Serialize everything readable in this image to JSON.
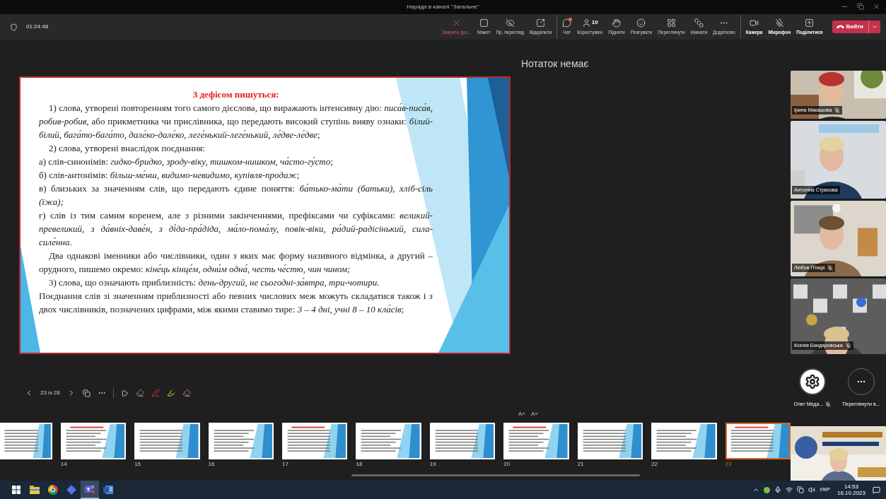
{
  "window": {
    "title": "Нарада в каналі \"Загальне\""
  },
  "meeting_bar": {
    "timer": "01:24:48",
    "action_groups": [
      [
        {
          "label": "Закрити дос...",
          "kind": "danger",
          "off": false,
          "notification": false
        },
        {
          "label": "Макет",
          "kind": "normal",
          "off": false,
          "notification": false
        },
        {
          "label": "Пр. перегляд",
          "kind": "normal",
          "off": true,
          "notification": false
        },
        {
          "label": "Відкріпити",
          "kind": "normal",
          "off": false,
          "notification": false
        }
      ],
      [
        {
          "label": "Чат",
          "kind": "normal",
          "off": false,
          "notification": true
        },
        {
          "label": "Користувачі",
          "kind": "normal",
          "off": false,
          "notification": false,
          "count": "10"
        },
        {
          "label": "Підняти",
          "kind": "normal",
          "off": false,
          "notification": false
        },
        {
          "label": "Реагувати",
          "kind": "normal",
          "off": false,
          "notification": false
        },
        {
          "label": "Переглянути",
          "kind": "normal",
          "off": false,
          "notification": false
        },
        {
          "label": "Кімнати",
          "kind": "normal",
          "off": false,
          "notification": false
        },
        {
          "label": "Додатково",
          "kind": "normal",
          "off": false,
          "notification": false
        }
      ],
      [
        {
          "label": "Камера",
          "kind": "device",
          "off": false,
          "notification": false
        },
        {
          "label": "Мікрофон",
          "kind": "device",
          "off": true,
          "notification": false
        },
        {
          "label": "Поділитися",
          "kind": "device",
          "off": false,
          "notification": false
        }
      ]
    ],
    "leave_button": {
      "label": "Вийти"
    }
  },
  "slide": {
    "title": "З дефісом пишуться:",
    "paragraphs": [
      {
        "kind": "indented",
        "text": "1) слова, утворені повторенням того самого дієслова, що виражають інтенсивну дію: *писа́в-писа́в, робив-робив*, або прикметника чи прислівника, що передають високий ступінь вияву ознаки: *білий-білий, бага́то-бага́то, дале́ко-дале́ко, леге́нький-леге́нький, ле́две-ле́две*;"
      },
      {
        "kind": "indented",
        "text": "2) слова, утворені внаслідок поєднання:"
      },
      {
        "kind": "plain",
        "text": "а) слів-синонімів: *гидко-бридко, зроду-віку, тишком-нишком, ча́сто-гу́сто*;"
      },
      {
        "kind": "plain",
        "text": "б) слів-антонімів: *більш-ме́нш, видимо-невидимо, купівля-продаж*;"
      },
      {
        "kind": "plain",
        "text": "в) близьких за значенням слів, що передають єдине поняття: *ба́тько-ма́ти (батьки), хліб-сіль (їжа);*"
      },
      {
        "kind": "plain",
        "text": "г) слів із тим самим коренем, але з різними закінченнями, префіксами чи суфіксами: *великий-превеликий, з да́вніх-даве́н, з ді́да-пра́діда, ма́ло-пома́лу, повік-віки, ра́дий-радісінький, сила-силе́нна*."
      },
      {
        "kind": "indented",
        "text": "Два однакові іменники або числівники, один з яких має форму називного відмінка, а другий – орудного, пишемо окремо: *кіне́ць кінце́м, одни́м одна́, честь че́стю, чин чином;*"
      },
      {
        "kind": "indented",
        "text": "3) слова, що означають приблизність: *день-другий, не сьогодні-за́втра, три-чотири.*"
      },
      {
        "kind": "plain",
        "text": "Поєднання слів зі значенням приблизності або певних числових меж можуть складатися також і з двох числівників, позначених цифрами, між якими ставимо тире: *3 – 4 дні, учні 8 – 10 кла́сів*;"
      }
    ]
  },
  "slide_controls": {
    "counter": "23 із 28"
  },
  "notes": {
    "text": "Нотаток немає",
    "font_buttons": [
      "A˄",
      "A˅"
    ]
  },
  "participants": [
    {
      "name": "Ірина Макашова",
      "muted": true
    },
    {
      "name": "Антоніна Страхова",
      "muted": false
    },
    {
      "name": "Любов Птиця",
      "muted": true
    },
    {
      "name": "Ксенія Бондаровська",
      "muted": true
    }
  ],
  "self_tile": {
    "name": "Олег Меда...",
    "muted": true
  },
  "more_button": {
    "label": "Переглянути в..."
  },
  "thumbnails": [
    {
      "selected": false
    },
    {
      "number": "14",
      "selected": false
    },
    {
      "number": "15",
      "selected": false
    },
    {
      "number": "16",
      "selected": false
    },
    {
      "number": "17",
      "selected": false
    },
    {
      "number": "18",
      "selected": false
    },
    {
      "number": "19",
      "selected": false
    },
    {
      "number": "20",
      "selected": false
    },
    {
      "number": "21",
      "selected": false
    },
    {
      "number": "22",
      "selected": false
    },
    {
      "number": "23",
      "selected": true
    }
  ],
  "taskbar": {
    "apps": [
      {
        "selected": false
      },
      {
        "selected": false
      },
      {
        "selected": false
      },
      {
        "selected": false
      },
      {
        "selected": true
      },
      {
        "selected": false
      }
    ],
    "language": "УКР",
    "time": "14:53",
    "date": "16.10.2023"
  }
}
